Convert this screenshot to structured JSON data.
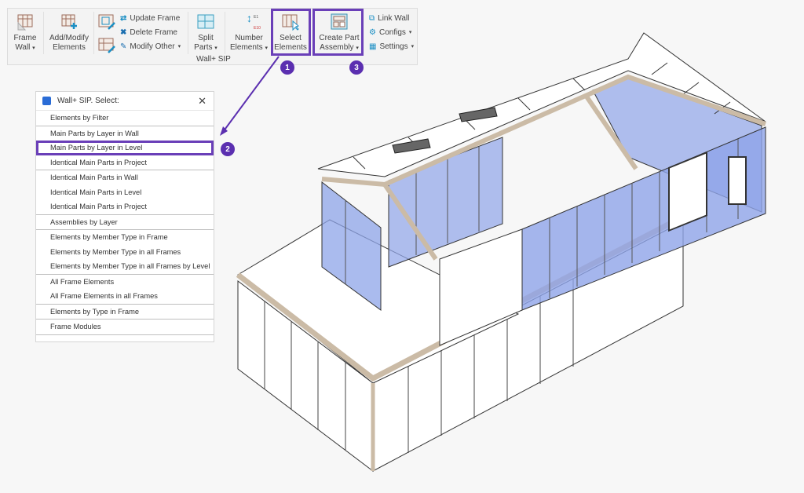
{
  "ribbon": {
    "buttons": [
      {
        "label_line1": "Frame",
        "label_line2": "Wall",
        "icon": "frame-wall-icon",
        "has_dropdown": true
      },
      {
        "label_line1": "Add/Modify",
        "label_line2": "Elements",
        "icon": "add-modify-elements-icon",
        "has_dropdown": false
      },
      {
        "label_line1": "Split",
        "label_line2": "Parts",
        "icon": "split-parts-icon",
        "has_dropdown": true
      },
      {
        "label_line1": "Number",
        "label_line2": "Elements",
        "icon": "number-elements-icon",
        "has_dropdown": true
      },
      {
        "label_line1": "Select",
        "label_line2": "Elements",
        "icon": "select-elements-icon",
        "has_dropdown": false
      },
      {
        "label_line1": "Create Part",
        "label_line2": "Assembly",
        "icon": "create-part-assembly-icon",
        "has_dropdown": true
      }
    ],
    "small_buttons": [
      {
        "label": "Update Frame",
        "icon": "update-frame-icon"
      },
      {
        "label": "Delete Frame",
        "icon": "delete-frame-icon"
      },
      {
        "label": "Modify Other",
        "icon": "modify-other-icon",
        "has_dropdown": true
      },
      {
        "label": "Link Wall",
        "icon": "link-wall-icon"
      },
      {
        "label": "Configs",
        "icon": "configs-icon",
        "has_dropdown": true
      },
      {
        "label": "Settings",
        "icon": "settings-icon",
        "has_dropdown": true
      }
    ],
    "number_icon_top": "E1",
    "number_icon_bottom": "E10",
    "group_label": "Wall+ SIP",
    "dropdown_glyph": "▾"
  },
  "callouts": [
    {
      "number": "1",
      "target": "Select Elements"
    },
    {
      "number": "2",
      "target": "Main Parts by Layer in Level"
    },
    {
      "number": "3",
      "target": "Create Part Assembly"
    }
  ],
  "panel": {
    "title": "Wall+ SIP. Select:",
    "close_glyph": "✕",
    "groups": [
      [
        "Elements by Filter"
      ],
      [
        "Main Parts by Layer in Wall",
        "Main Parts by Layer in Level",
        "Identical Main Parts in Project"
      ],
      [
        "Identical Main Parts in Wall",
        "Identical Main Parts in Level",
        "Identical Main Parts in Project"
      ],
      [
        "Assemblies by Layer"
      ],
      [
        "Elements by Member Type in Frame",
        "Elements by Member Type in all Frames",
        "Elements by Member Type in all Frames by Level"
      ],
      [
        "All Frame Elements",
        "All Frame Elements in all Frames"
      ],
      [
        "Elements by Type in Frame"
      ],
      [
        "Frame Modules"
      ]
    ],
    "selected_item": "Main Parts by Layer in Level"
  },
  "colors": {
    "highlight": "#6a3fb8",
    "badge": "#5b2fb0",
    "glass": "#8ea4e8",
    "timber": "#cbbba6",
    "accent_icon": "#1b8fc4"
  }
}
